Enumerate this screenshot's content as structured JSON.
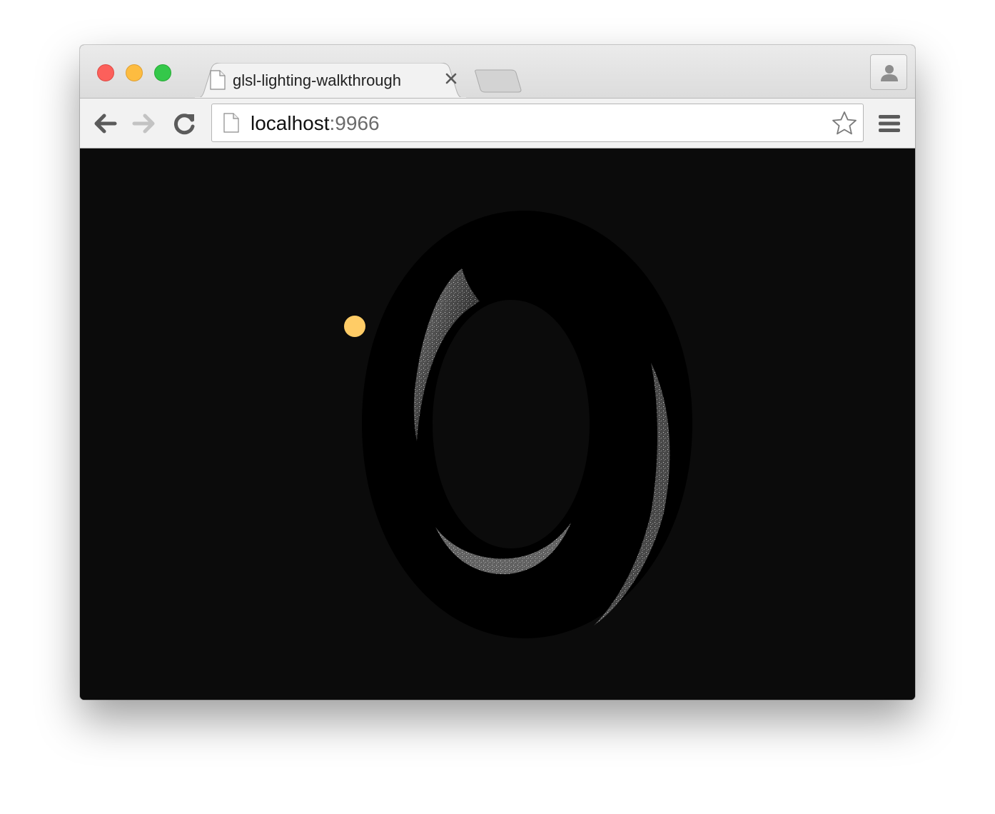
{
  "window": {
    "controls": {
      "close": "close",
      "minimize": "minimize",
      "maximize": "maximize"
    }
  },
  "tabs": [
    {
      "title": "glsl-lighting-walkthrough",
      "icon": "page-icon",
      "active": true
    }
  ],
  "tab_close_icon": "close-icon",
  "new_tab_icon": "new-tab-icon",
  "profile_icon": "person-icon",
  "toolbar": {
    "back_icon": "arrow-left-icon",
    "forward_icon": "arrow-right-icon",
    "forward_enabled": false,
    "reload_icon": "reload-icon",
    "menu_icon": "hamburger-menu-icon",
    "bookmark_icon": "star-icon"
  },
  "address_bar": {
    "host": "localhost",
    "port": ":9966",
    "icon": "page-icon"
  },
  "content": {
    "background_color": "#0b0b0b",
    "light_color": "#ffcc66",
    "torus_color": "#000000",
    "highlight_color": "#ffffff"
  }
}
